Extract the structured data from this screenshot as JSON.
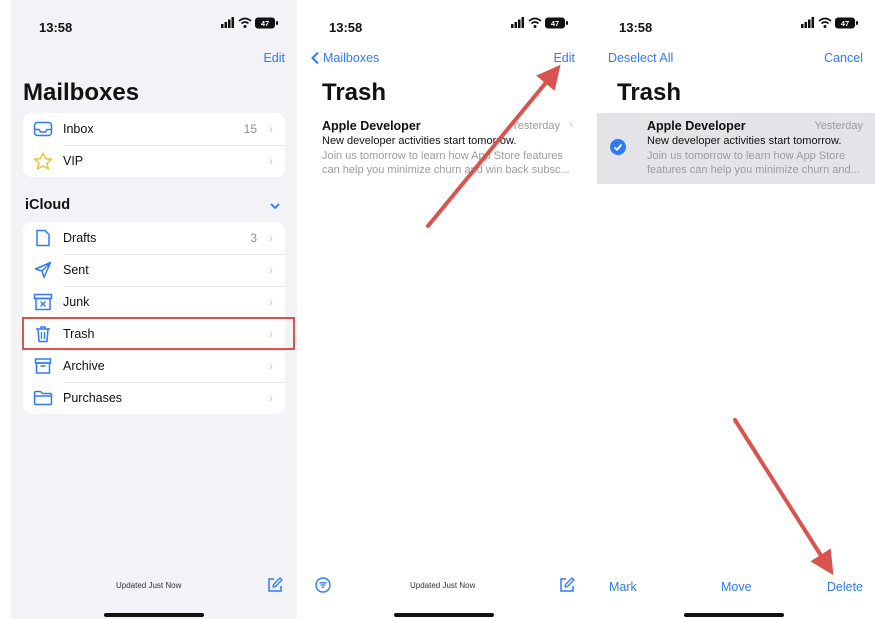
{
  "colors": {
    "accent": "#2f7bf5",
    "annotation_red": "#d9534f",
    "panel_bg": "#f2f2f7"
  },
  "status_bar": {
    "time": "13:58",
    "battery": "47"
  },
  "screen1": {
    "edit_label": "Edit",
    "title": "Mailboxes",
    "top_items": [
      {
        "label": "Inbox",
        "count": "15",
        "icon": "inbox-icon"
      },
      {
        "label": "VIP",
        "count": "",
        "icon": "star-icon"
      }
    ],
    "section_title": "iCloud",
    "icloud_items": [
      {
        "label": "Drafts",
        "count": "3",
        "icon": "document-icon"
      },
      {
        "label": "Sent",
        "count": "",
        "icon": "paper-plane-icon"
      },
      {
        "label": "Junk",
        "count": "",
        "icon": "junk-box-icon"
      },
      {
        "label": "Trash",
        "count": "",
        "icon": "trash-icon"
      },
      {
        "label": "Archive",
        "count": "",
        "icon": "archive-box-icon"
      },
      {
        "label": "Purchases",
        "count": "",
        "icon": "folder-icon"
      }
    ],
    "footer": "Updated Just Now"
  },
  "screen2": {
    "back_label": "Mailboxes",
    "edit_label": "Edit",
    "title": "Trash",
    "message": {
      "sender": "Apple Developer",
      "date": "Yesterday",
      "subject": "New developer activities start tomorrow.",
      "preview_line1": "Join us tomorrow to learn how App Store features",
      "preview_line2": "can help you minimize churn and win back subsc..."
    },
    "footer": "Updated Just Now"
  },
  "screen3": {
    "deselect_label": "Deselect All",
    "cancel_label": "Cancel",
    "title": "Trash",
    "message": {
      "sender": "Apple Developer",
      "date": "Yesterday",
      "subject": "New developer activities start tomorrow.",
      "preview_line1": "Join us tomorrow to learn how App Store",
      "preview_line2": "features can help you minimize churn and..."
    },
    "toolbar": {
      "mark": "Mark",
      "move": "Move",
      "delete": "Delete"
    }
  }
}
